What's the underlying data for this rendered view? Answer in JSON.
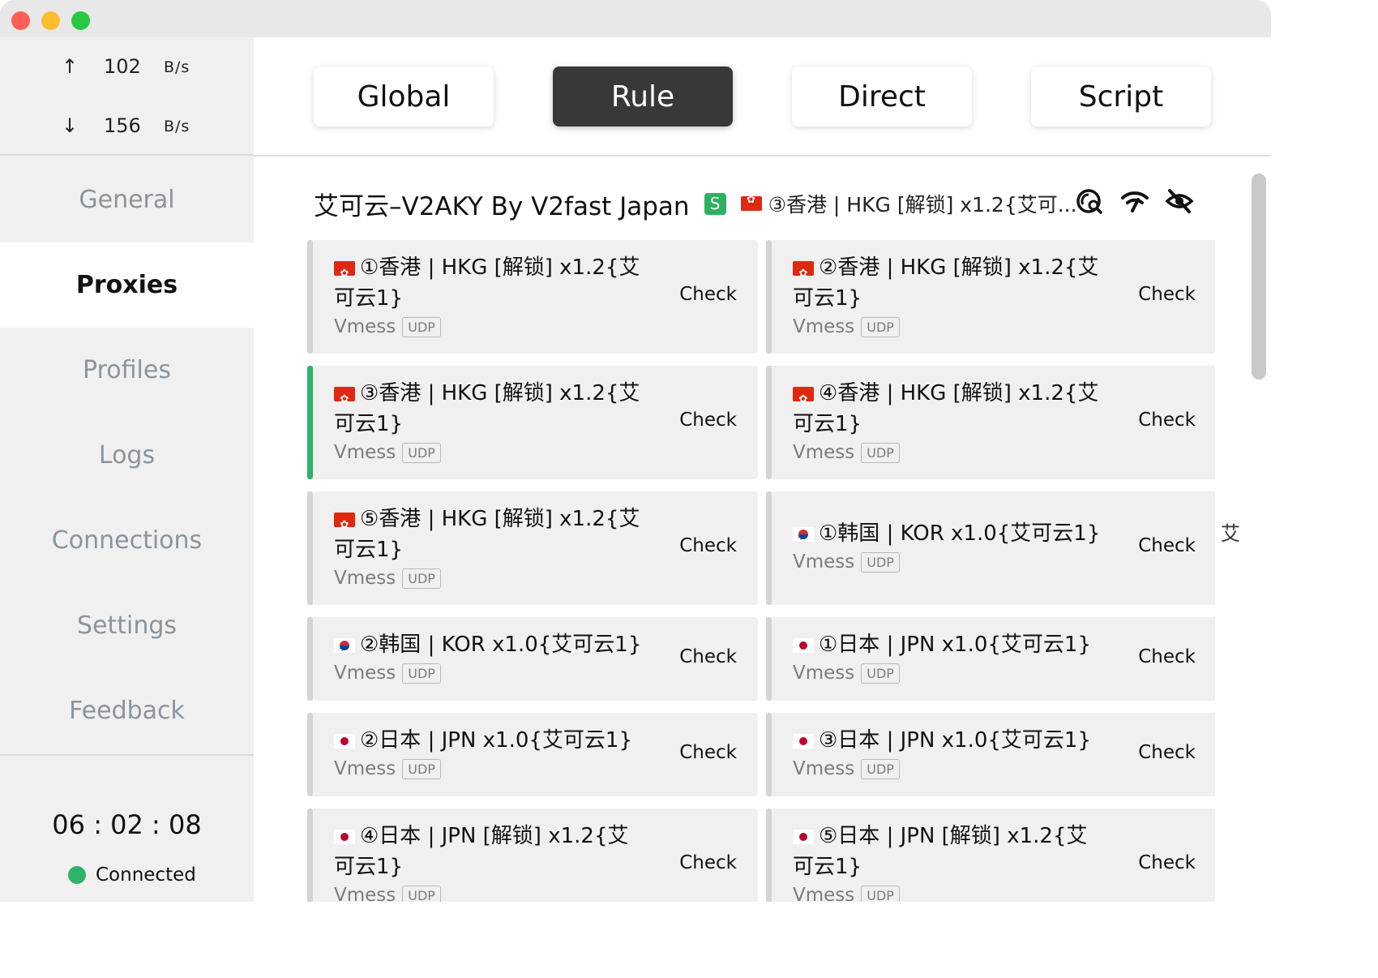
{
  "window": {
    "title": ""
  },
  "traffic": {
    "up_arrow": "↑",
    "up_value": "102",
    "up_unit": "B/s",
    "down_arrow": "↓",
    "down_value": "156",
    "down_unit": "B/s"
  },
  "sidebar": {
    "items": [
      {
        "label": "General"
      },
      {
        "label": "Proxies"
      },
      {
        "label": "Profiles"
      },
      {
        "label": "Logs"
      },
      {
        "label": "Connections"
      },
      {
        "label": "Settings"
      },
      {
        "label": "Feedback"
      }
    ],
    "active": "Proxies"
  },
  "footer": {
    "timer": "06 : 02 : 08",
    "status": "Connected",
    "status_color": "#2eb36a"
  },
  "modes": {
    "items": [
      {
        "label": "Global"
      },
      {
        "label": "Rule"
      },
      {
        "label": "Direct"
      },
      {
        "label": "Script"
      }
    ],
    "active": "Rule"
  },
  "group": {
    "title": "艾可云–V2AKY By V2fast Japan",
    "badge": "S",
    "selected_proxy": "③香港 | HKG [解锁] x1.2{艾可...",
    "icons": [
      "speed-test-icon",
      "wifi-icon",
      "eye-off-icon"
    ]
  },
  "proxies": [
    {
      "flag": "hk",
      "name": "①香港 | HKG [解锁] x1.2{艾可云1}",
      "type": "Vmess",
      "udp": "UDP",
      "check": "Check"
    },
    {
      "flag": "hk",
      "name": "②香港 | HKG [解锁] x1.2{艾可云1}",
      "type": "Vmess",
      "udp": "UDP",
      "check": "Check"
    },
    {
      "flag": "hk",
      "name": "③香港 | HKG [解锁] x1.2{艾可云1}",
      "type": "Vmess",
      "udp": "UDP",
      "check": "Check",
      "selected": true
    },
    {
      "flag": "hk",
      "name": "④香港 | HKG [解锁] x1.2{艾可云1}",
      "type": "Vmess",
      "udp": "UDP",
      "check": "Check"
    },
    {
      "flag": "hk",
      "name": "⑤香港 | HKG [解锁] x1.2{艾可云1}",
      "type": "Vmess",
      "udp": "UDP",
      "check": "Check"
    },
    {
      "flag": "kr",
      "name": "①韩国 | KOR x1.0{艾可云1}",
      "type": "Vmess",
      "udp": "UDP",
      "check": "Check"
    },
    {
      "flag": "kr",
      "name": "②韩国 | KOR x1.0{艾可云1}",
      "type": "Vmess",
      "udp": "UDP",
      "check": "Check"
    },
    {
      "flag": "jp",
      "name": "①日本 | JPN x1.0{艾可云1}",
      "type": "Vmess",
      "udp": "UDP",
      "check": "Check"
    },
    {
      "flag": "jp",
      "name": "②日本 | JPN x1.0{艾可云1}",
      "type": "Vmess",
      "udp": "UDP",
      "check": "Check"
    },
    {
      "flag": "jp",
      "name": "③日本 | JPN x1.0{艾可云1}",
      "type": "Vmess",
      "udp": "UDP",
      "check": "Check"
    },
    {
      "flag": "jp",
      "name": "④日本 | JPN [解锁] x1.2{艾可云1}",
      "type": "Vmess",
      "udp": "UDP",
      "check": "Check"
    },
    {
      "flag": "jp",
      "name": "⑤日本 | JPN [解锁] x1.2{艾可云1}",
      "type": "Vmess",
      "udp": "UDP",
      "check": "Check"
    }
  ],
  "index_char": "艾"
}
